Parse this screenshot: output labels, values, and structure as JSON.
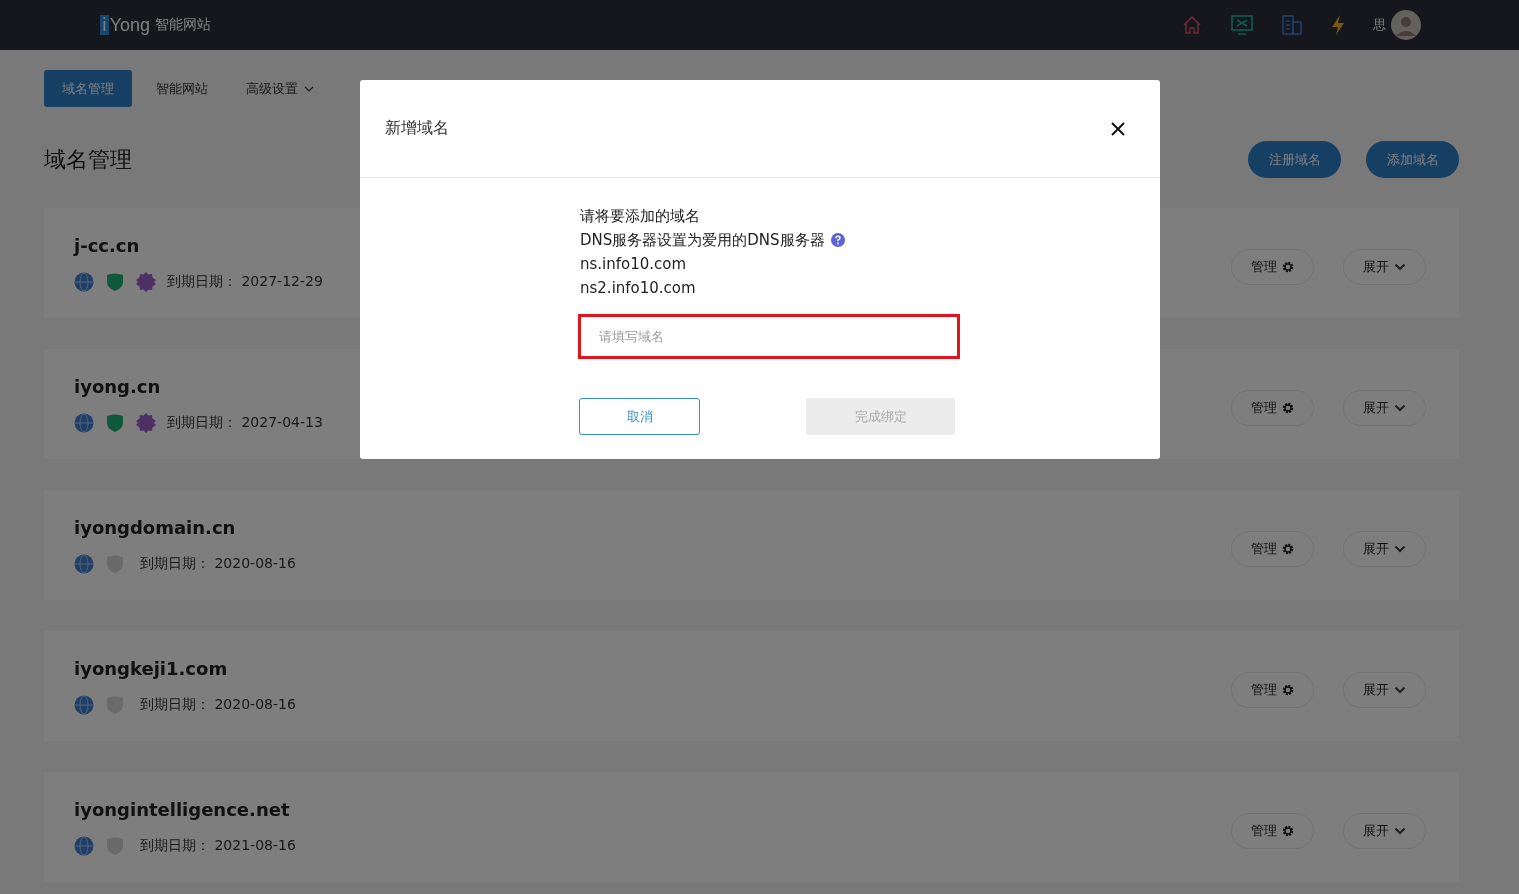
{
  "header": {
    "logo": {
      "mark": "i",
      "name": "Yong",
      "product": "智能网站"
    },
    "user": {
      "name": "思"
    }
  },
  "nav": {
    "tabs": [
      {
        "label": "域名管理",
        "selected": true,
        "has_menu": false
      },
      {
        "label": "智能网站",
        "selected": false,
        "has_menu": false
      },
      {
        "label": "高级设置",
        "selected": false,
        "has_menu": true
      }
    ]
  },
  "page": {
    "title": "域名管理",
    "actions": [
      "注册域名",
      "添加域名"
    ]
  },
  "domains": [
    {
      "name": "j-cc.cn",
      "icp": true,
      "third_party": true,
      "expiry_label": "到期日期：",
      "expiry": "2027-12-29",
      "manage": "管理",
      "expand": "展开"
    },
    {
      "name": "iyong.cn",
      "icp": true,
      "third_party": true,
      "expiry_label": "到期日期：",
      "expiry": "2027-04-13",
      "manage": "管理",
      "expand": "展开"
    },
    {
      "name": "iyongdomain.cn",
      "icp": false,
      "third_party": false,
      "expiry_label": "到期日期：",
      "expiry": "2020-08-16",
      "manage": "管理",
      "expand": "展开"
    },
    {
      "name": "iyongkeji1.com",
      "icp": false,
      "third_party": false,
      "expiry_label": "到期日期：",
      "expiry": "2020-08-16",
      "manage": "管理",
      "expand": "展开"
    },
    {
      "name": "iyongintelligence.net",
      "icp": false,
      "third_party": false,
      "expiry_label": "到期日期：",
      "expiry": "2021-08-16",
      "manage": "管理",
      "expand": "展开"
    }
  ],
  "dialog": {
    "title": "新增域名",
    "lines": [
      "请将要添加的域名",
      "DNS服务器设置为爱用的DNS服务器",
      "ns.info10.com",
      "ns2.info10.com"
    ],
    "input": {
      "placeholder": "请填写域名",
      "highlighted": true
    },
    "cancel": {
      "label": "取消",
      "disabled": false
    },
    "confirm": {
      "label": "完成绑定",
      "disabled": true
    }
  }
}
